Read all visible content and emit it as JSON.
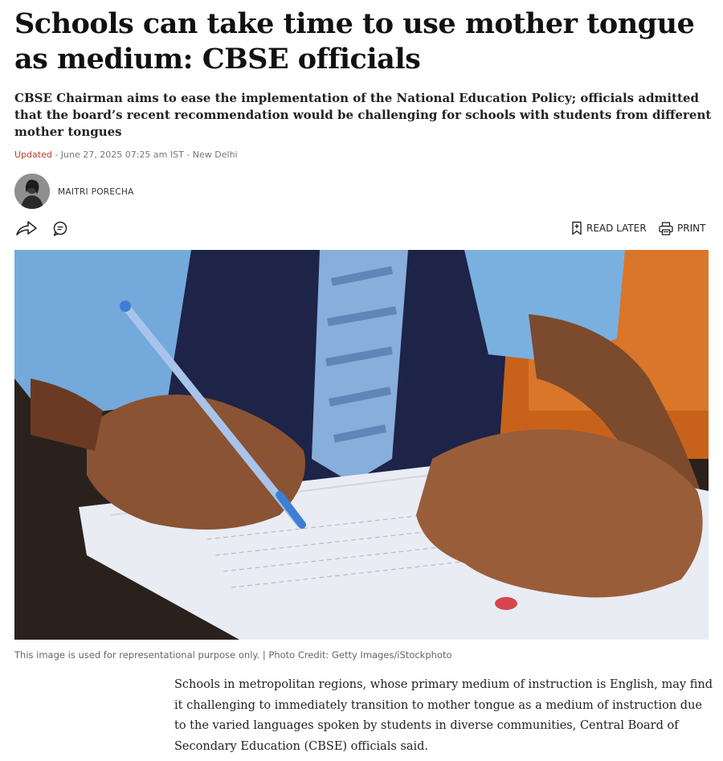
{
  "article": {
    "headline": "Schools can take time to use mother tongue as medium: CBSE officials",
    "standfirst": "CBSE Chairman aims to ease the implementation of the National Education Policy; officials admitted that the board’s recent recommendation would be challenging for schools with students from different mother tongues",
    "updated_label": "Updated",
    "dateline": " - June 27, 2025 07:25 am IST - New Delhi",
    "author": "MAITRI PORECHA",
    "caption": "This image is used for representational purpose only. | Photo Credit: Getty Images/iStockphoto",
    "body": "Schools in metropolitan regions, whose primary medium of instruction is English, may find it challenging to immediately transition to mother tongue as a medium of instruction due to the varied languages spoken by students in diverse communities, Central Board of Secondary Education (CBSE) officials said."
  },
  "actions": {
    "read_later": "READ LATER",
    "print": "PRINT",
    "share_icon": "share-icon",
    "comment_icon": "comment-icon",
    "bookmark_icon": "bookmark-icon",
    "print_icon": "print-icon"
  },
  "colors": {
    "updated": "#c0392b",
    "text": "#111111",
    "muted": "#777777"
  }
}
